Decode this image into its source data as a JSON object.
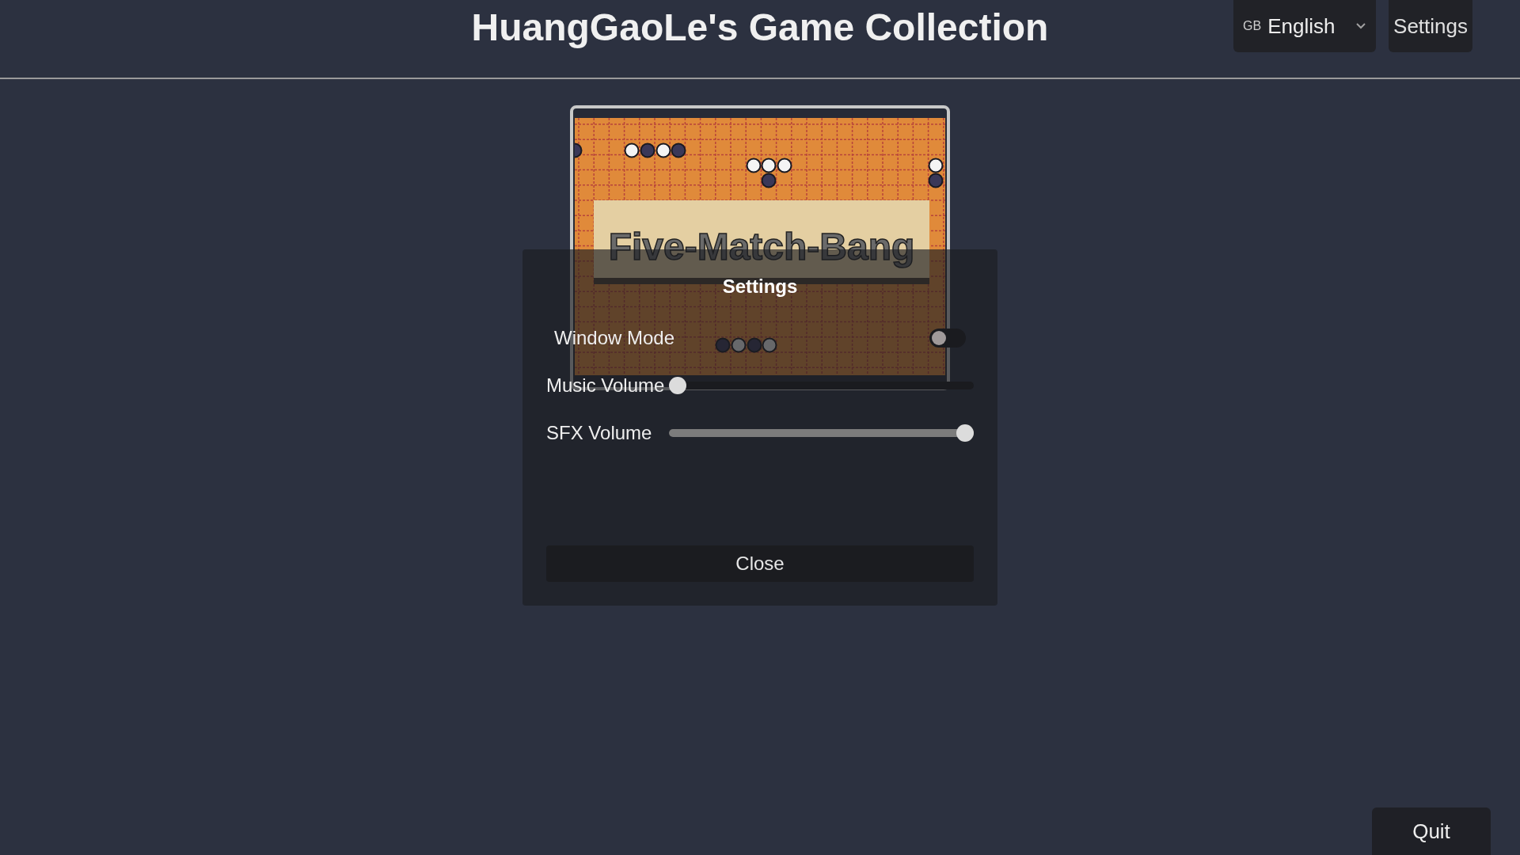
{
  "header": {
    "title": "HuangGaoLe's Game Collection",
    "language": {
      "flag": "GB",
      "label": "English"
    },
    "settings_button": "Settings"
  },
  "games": [
    {
      "title": "Five-Match-Bang"
    }
  ],
  "dialog": {
    "title": "Settings",
    "options": [
      {
        "kind": "toggle",
        "label": "Window Mode",
        "on": false
      },
      {
        "kind": "slider",
        "label": "Music Volume",
        "level": 0
      },
      {
        "kind": "slider",
        "label": "SFX Volume",
        "level": 1
      }
    ],
    "close_button": "Close"
  },
  "quit_button": "Quit"
}
